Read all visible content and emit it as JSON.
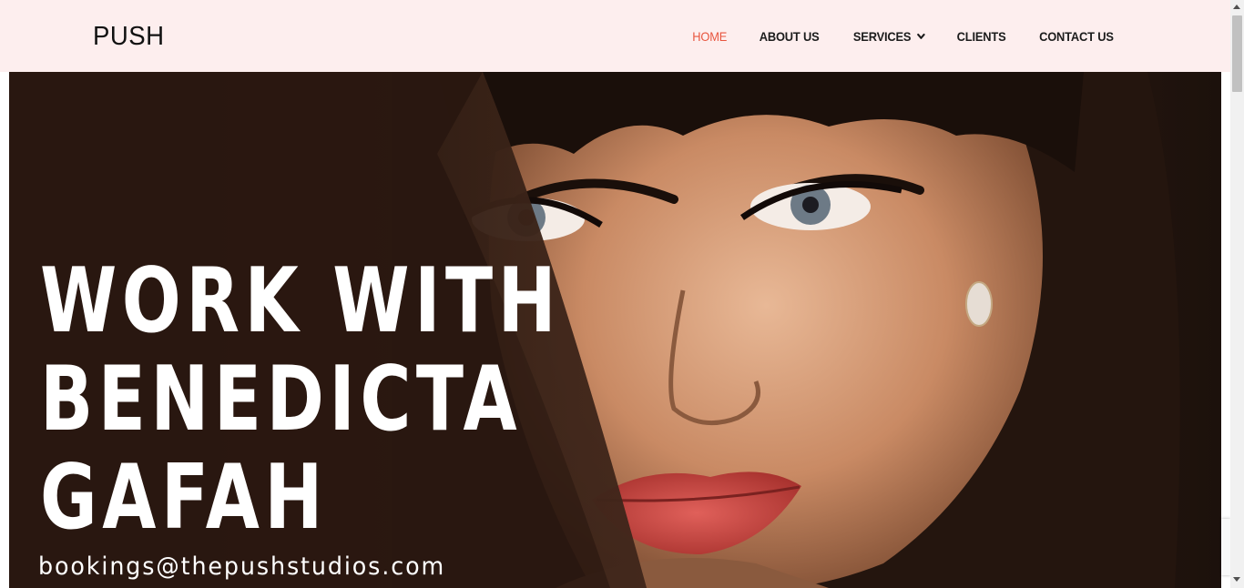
{
  "header": {
    "logo": "PUSH",
    "nav": [
      {
        "label": "HOME",
        "active": true
      },
      {
        "label": "ABOUT US",
        "active": false
      },
      {
        "label": "SERVICES",
        "active": false,
        "has_dropdown": true
      },
      {
        "label": "CLIENTS",
        "active": false
      },
      {
        "label": "CONTACT US",
        "active": false
      }
    ]
  },
  "hero": {
    "title_lines": [
      "WORK WITH",
      "BENEDICTA",
      "GAFAH"
    ],
    "email": "bookings@thepushstudios.com"
  },
  "colors": {
    "header_bg": "#fdeeee",
    "nav_active": "#e8553e",
    "nav_text": "#1c1c1c",
    "hero_bg": "#2b1a12",
    "hero_text": "#ffffff"
  },
  "icons": {
    "dropdown": "chevron-down-icon"
  }
}
